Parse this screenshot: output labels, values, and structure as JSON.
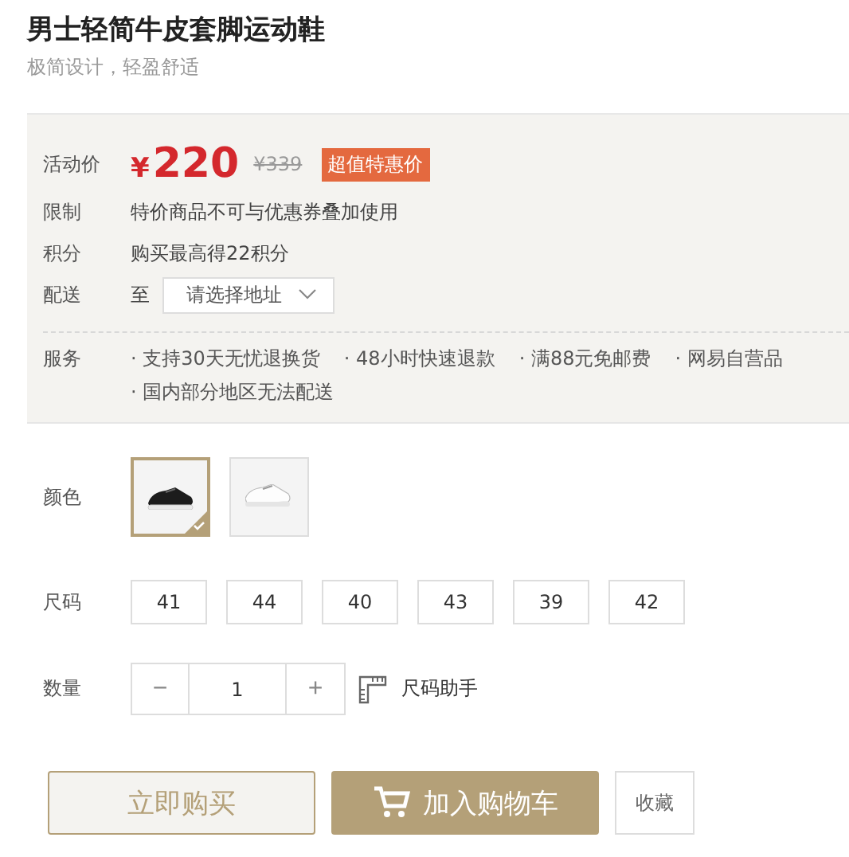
{
  "title": "男士轻简牛皮套脚运动鞋",
  "subtitle": "极简设计，轻盈舒适",
  "price": {
    "label": "活动价",
    "currency": "¥",
    "value": "220",
    "original": "¥339",
    "badge": "超值特惠价"
  },
  "info_rows": [
    {
      "label": "限制",
      "value": "特价商品不可与优惠券叠加使用"
    },
    {
      "label": "积分",
      "value": "购买最高得22积分"
    }
  ],
  "delivery": {
    "label": "配送",
    "prefix": "至",
    "placeholder": "请选择地址"
  },
  "services": {
    "label": "服务",
    "items": [
      "· 支持30天无忧退换货",
      "· 48小时快速退款",
      "· 满88元免邮费",
      "· 网易自营品",
      "· 国内部分地区无法配送"
    ]
  },
  "colors": {
    "label": "颜色",
    "options": [
      {
        "kind": "black",
        "selected": true
      },
      {
        "kind": "white",
        "selected": false
      }
    ]
  },
  "sizes": {
    "label": "尺码",
    "options": [
      {
        "label": "41",
        "selected": false
      },
      {
        "label": "44",
        "selected": false
      },
      {
        "label": "40",
        "selected": false
      },
      {
        "label": "43",
        "selected": false
      },
      {
        "label": "39",
        "selected": false
      },
      {
        "label": "42",
        "selected": false
      }
    ]
  },
  "quantity": {
    "label": "数量",
    "minus": "−",
    "value": "1",
    "plus": "+",
    "size_helper": "尺码助手"
  },
  "actions": {
    "buy": "立即购买",
    "cart": "加入购物车",
    "favorite": "收藏"
  }
}
